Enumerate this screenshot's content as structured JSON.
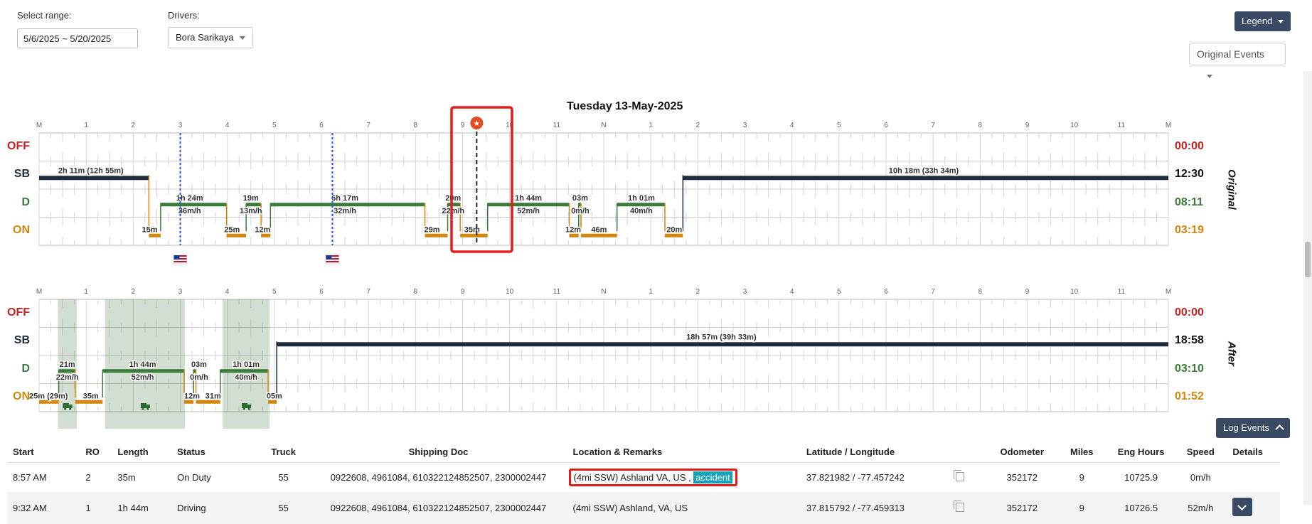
{
  "controls": {
    "range_label": "Select range:",
    "range_value": "5/6/2025 ~ 5/20/2025",
    "drivers_label": "Drivers:",
    "driver_value": "Bora Sarikaya",
    "legend_button": "Legend",
    "events_select": "Original Events",
    "log_events_button": "Log Events"
  },
  "chart_title": "Tuesday 13-May-2025",
  "hour_ticks": [
    "M",
    "1",
    "2",
    "3",
    "4",
    "5",
    "6",
    "7",
    "8",
    "9",
    "10",
    "11",
    "N",
    "1",
    "2",
    "3",
    "4",
    "5",
    "6",
    "7",
    "8",
    "9",
    "10",
    "11",
    "M"
  ],
  "status_labels": [
    "OFF",
    "SB",
    "D",
    "ON"
  ],
  "colors": {
    "off": "#cc1f1f",
    "sb": "#1f2d3d",
    "driving": "#3a7a3a",
    "on_duty": "#d4860b",
    "highlight": "#e31b1b",
    "accent": "#3b4a63"
  },
  "original": {
    "side_label": "Original",
    "totals": [
      "00:00",
      "12:30",
      "08:11",
      "03:19"
    ],
    "segments": [
      {
        "status": "SB",
        "start": 0,
        "end": 2.333
      },
      {
        "status": "ON",
        "start": 2.333,
        "end": 2.583
      },
      {
        "status": "D",
        "start": 2.583,
        "end": 3.983
      },
      {
        "status": "ON",
        "start": 3.983,
        "end": 4.4
      },
      {
        "status": "D",
        "start": 4.4,
        "end": 4.717
      },
      {
        "status": "ON",
        "start": 4.717,
        "end": 4.917
      },
      {
        "status": "D",
        "start": 4.917,
        "end": 8.2
      },
      {
        "status": "ON",
        "start": 8.2,
        "end": 8.683
      },
      {
        "status": "D",
        "start": 8.683,
        "end": 8.95
      },
      {
        "status": "ON",
        "start": 8.95,
        "end": 9.533
      },
      {
        "status": "D",
        "start": 9.533,
        "end": 11.267
      },
      {
        "status": "ON",
        "start": 11.267,
        "end": 11.467
      },
      {
        "status": "D",
        "start": 11.467,
        "end": 11.517
      },
      {
        "status": "ON",
        "start": 11.517,
        "end": 12.283
      },
      {
        "status": "D",
        "start": 12.283,
        "end": 13.3
      },
      {
        "status": "ON",
        "start": 13.3,
        "end": 13.683
      },
      {
        "status": "SB",
        "start": 13.683,
        "end": 24
      }
    ],
    "labels": [
      {
        "text": "2h 11m (12h 55m)",
        "t": 1.1,
        "row": "SB"
      },
      {
        "text": "15m",
        "t": 2.35,
        "row": "ON"
      },
      {
        "text": "1h 24m",
        "t": 3.2,
        "row": "D"
      },
      {
        "text": "36m/h",
        "t": 3.2,
        "row": "Dsub"
      },
      {
        "text": "25m",
        "t": 4.1,
        "row": "ON"
      },
      {
        "text": "19m",
        "t": 4.5,
        "row": "D"
      },
      {
        "text": "13m/h",
        "t": 4.5,
        "row": "Dsub"
      },
      {
        "text": "12m",
        "t": 4.75,
        "row": "ON"
      },
      {
        "text": "6h 17m",
        "t": 6.5,
        "row": "D"
      },
      {
        "text": "32m/h",
        "t": 6.5,
        "row": "Dsub"
      },
      {
        "text": "29m",
        "t": 8.35,
        "row": "ON"
      },
      {
        "text": "20m",
        "t": 8.8,
        "row": "D"
      },
      {
        "text": "22m/h",
        "t": 8.8,
        "row": "Dsub"
      },
      {
        "text": "35m",
        "t": 9.2,
        "row": "ON"
      },
      {
        "text": "1h 44m",
        "t": 10.4,
        "row": "D"
      },
      {
        "text": "52m/h",
        "t": 10.4,
        "row": "Dsub"
      },
      {
        "text": "03m",
        "t": 11.5,
        "row": "D"
      },
      {
        "text": "0m/h",
        "t": 11.5,
        "row": "Dsub"
      },
      {
        "text": "12m",
        "t": 11.35,
        "row": "ON"
      },
      {
        "text": "46m",
        "t": 11.9,
        "row": "ON"
      },
      {
        "text": "1h 01m",
        "t": 12.8,
        "row": "D"
      },
      {
        "text": "40m/h",
        "t": 12.8,
        "row": "Dsub"
      },
      {
        "text": "20m",
        "t": 13.5,
        "row": "ON"
      },
      {
        "text": "10h 18m (33h 34m)",
        "t": 18.8,
        "row": "SB"
      }
    ],
    "border_markers": [
      3.0,
      6.233
    ],
    "event_marker": 9.3
  },
  "after": {
    "side_label": "After",
    "totals": [
      "00:00",
      "18:58",
      "03:10",
      "01:52"
    ],
    "segments": [
      {
        "status": "ON",
        "start": 0,
        "end": 0.417
      },
      {
        "status": "D",
        "start": 0.417,
        "end": 0.767
      },
      {
        "status": "ON",
        "start": 0.767,
        "end": 1.35
      },
      {
        "status": "D",
        "start": 1.35,
        "end": 3.083
      },
      {
        "status": "ON",
        "start": 3.083,
        "end": 3.283
      },
      {
        "status": "D",
        "start": 3.283,
        "end": 3.333
      },
      {
        "status": "ON",
        "start": 3.333,
        "end": 3.85
      },
      {
        "status": "D",
        "start": 3.85,
        "end": 4.867
      },
      {
        "status": "ON",
        "start": 4.867,
        "end": 5.05
      },
      {
        "status": "SB",
        "start": 5.05,
        "end": 24
      }
    ],
    "shaded": [
      [
        0.4,
        0.8
      ],
      [
        1.4,
        3.1
      ],
      [
        3.9,
        4.9
      ]
    ],
    "labels": [
      {
        "text": "25m (29m)",
        "t": 0.2,
        "row": "ON"
      },
      {
        "text": "21m",
        "t": 0.6,
        "row": "D"
      },
      {
        "text": "22m/h",
        "t": 0.6,
        "row": "Dsub"
      },
      {
        "text": "35m",
        "t": 1.1,
        "row": "ON"
      },
      {
        "text": "1h 44m",
        "t": 2.2,
        "row": "D"
      },
      {
        "text": "52m/h",
        "t": 2.2,
        "row": "Dsub"
      },
      {
        "text": "03m",
        "t": 3.4,
        "row": "D"
      },
      {
        "text": "0m/h",
        "t": 3.4,
        "row": "Dsub"
      },
      {
        "text": "12m",
        "t": 3.25,
        "row": "ON"
      },
      {
        "text": "31m",
        "t": 3.7,
        "row": "ON"
      },
      {
        "text": "1h 01m",
        "t": 4.4,
        "row": "D"
      },
      {
        "text": "40m/h",
        "t": 4.4,
        "row": "Dsub"
      },
      {
        "text": "05m",
        "t": 5.0,
        "row": "ON"
      },
      {
        "text": "18h 57m (39h 33m)",
        "t": 14.5,
        "row": "SB"
      }
    ],
    "truck_icons": [
      0.6,
      2.25,
      4.4
    ]
  },
  "table": {
    "headers": [
      "Start",
      "RO",
      "Length",
      "Status",
      "Truck",
      "Shipping Doc",
      "Location & Remarks",
      "Latitude / Longitude",
      "",
      "Odometer",
      "Miles",
      "Eng Hours",
      "Speed",
      "Details"
    ],
    "rows": [
      {
        "start": "8:57 AM",
        "ro": "2",
        "length": "35m",
        "status": "On Duty",
        "truck": "55",
        "shipping": "0922608, 4961084, 610322124852507, 2300002447",
        "location": "(4mi SSW) Ashland VA, US ,",
        "remark": "accident",
        "latlng": "37.821982 / -77.457242",
        "odometer": "352172",
        "miles": "9",
        "eng_hours": "10725.9",
        "speed": "0m/h"
      },
      {
        "start": "9:32 AM",
        "ro": "1",
        "length": "1h 44m",
        "status": "Driving",
        "truck": "55",
        "shipping": "0922608, 4961084, 610322124852507, 2300002447",
        "location": "(4mi SSW) Ashland, VA, US",
        "remark": "",
        "latlng": "37.815792 / -77.459313",
        "odometer": "352172",
        "miles": "9",
        "eng_hours": "10726.5",
        "speed": "52m/h"
      }
    ]
  }
}
